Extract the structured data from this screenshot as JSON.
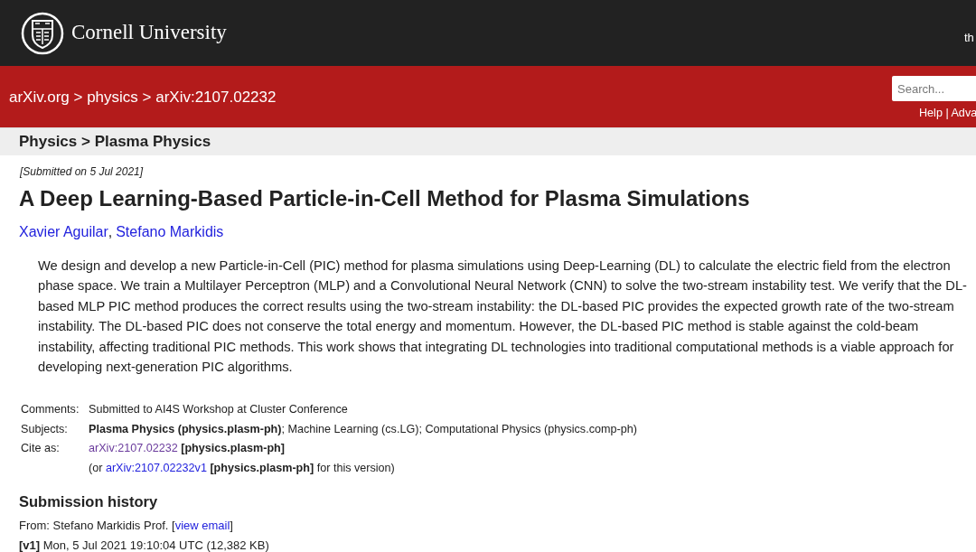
{
  "header": {
    "university": "Cornell University",
    "top_right": "th"
  },
  "nav": {
    "breadcrumb": "arXiv.org > physics > arXiv:2107.02232",
    "search": {
      "placeholder": "Search..."
    },
    "links": "Help | Adva"
  },
  "subject_bar": "Physics > Plasma Physics",
  "submitted": "[Submitted on 5 Jul 2021]",
  "title": "A Deep Learning-Based Particle-in-Cell Method for Plasma Simulations",
  "authors": [
    "Xavier Aguilar",
    "Stefano Markidis"
  ],
  "author_separator": ",",
  "abstract": "We design and develop a new Particle-in-Cell (PIC) method for plasma simulations using Deep-Learning (DL) to calculate the electric field from the electron phase space. We train a Multilayer Perceptron (MLP) and a Convolutional Neural Network (CNN) to solve the two-stream instability test. We verify that the DL-based MLP PIC method produces the correct results using the two-stream instability: the DL-based PIC provides the expected growth rate of the two-stream instability. The DL-based PIC does not conserve the total energy and momentum. However, the DL-based PIC method is stable against the cold-beam instability, affecting traditional PIC methods. This work shows that integrating DL technologies into traditional computational methods is a viable approach for developing next-generation PIC algorithms.",
  "metadata": [
    {
      "label": "Comments:",
      "text": "Submitted to AI4S Workshop at Cluster Conference"
    },
    {
      "label": "Subjects:",
      "text": "**Plasma Physics (physics.plasm-ph)**; Machine Learning (cs.LG); Computational Physics (physics.comp-ph)"
    }
  ],
  "cite_as": {
    "label": "Cite as:",
    "lines": [
      {
        "link": "arXiv:2107.02232",
        "visited": true,
        "suffix": " **[physics.plasm-ph]**"
      },
      {
        "prefix": "(or ",
        "link": "arXiv:2107.02232v1",
        "visited": false,
        "suffix": " **[physics.plasm-ph]** for this version)"
      }
    ]
  },
  "history": {
    "heading": "Submission history",
    "from": {
      "prefix": "From: Stefano Markidis Prof. [",
      "link": "view email",
      "suffix": "]"
    },
    "versions": [
      {
        "label": "[v1]",
        "text": "Mon, 5 Jul 2021 19:10:04 UTC (12,382 KB)"
      }
    ]
  }
}
